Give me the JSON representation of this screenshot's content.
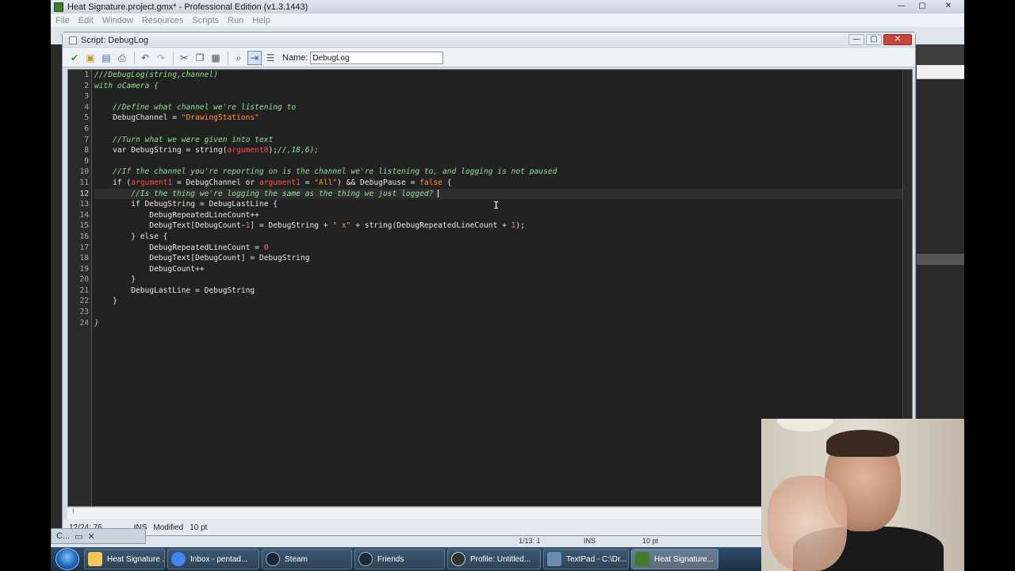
{
  "app": {
    "title": "Heat Signature.project.gmx*  -  Professional Edition (v1.3.1443)",
    "menu": [
      "File",
      "Edit",
      "Window",
      "Resources",
      "Scripts",
      "Run",
      "Help"
    ],
    "winctl": {
      "minimize": "—",
      "restore": "▢",
      "close": "✕"
    }
  },
  "script_window": {
    "title": "Script: DebugLog",
    "name_label": "Name:",
    "name_value": "DebugLog",
    "toolbar_icons": [
      "check-icon",
      "open-icon",
      "save-icon",
      "print-icon",
      "undo-icon",
      "redo-icon",
      "cut-icon",
      "copy-icon",
      "paste-icon",
      "find-icon",
      "goto-icon",
      "indent-icon"
    ]
  },
  "editor": {
    "line_numbers": [
      "1",
      "2",
      "3",
      "4",
      "5",
      "6",
      "7",
      "8",
      "9",
      "10",
      "11",
      "12",
      "13",
      "14",
      "15",
      "16",
      "17",
      "18",
      "19",
      "20",
      "21",
      "22",
      "23",
      "24"
    ],
    "current_line": 12
  },
  "status": {
    "position": "12/24: 76",
    "mode": "INS",
    "modified": "Modified",
    "font_size": "10 pt",
    "warn": "!"
  },
  "bg_status": {
    "pos": "1/13:  1",
    "mode": "INS",
    "size": "10 pt"
  },
  "taskbar": {
    "items": [
      {
        "label": "Heat Signature ...",
        "icon": "folder-icon",
        "color": "#f1c65a"
      },
      {
        "label": "Inbox - pentad...",
        "icon": "chrome-icon",
        "color": "#4285f4"
      },
      {
        "label": "Steam",
        "icon": "steam-icon",
        "color": "#1b2838"
      },
      {
        "label": "Friends",
        "icon": "steam-icon",
        "color": "#1b2838"
      },
      {
        "label": "Profile: Untitled...",
        "icon": "obs-icon",
        "color": "#333333"
      },
      {
        "label": "TextPad - C:\\Dr...",
        "icon": "textpad-icon",
        "color": "#6a8caf"
      },
      {
        "label": "Heat Signature...",
        "icon": "gamemaker-icon",
        "color": "#3f7d2c"
      }
    ],
    "mini_label": "C..."
  }
}
